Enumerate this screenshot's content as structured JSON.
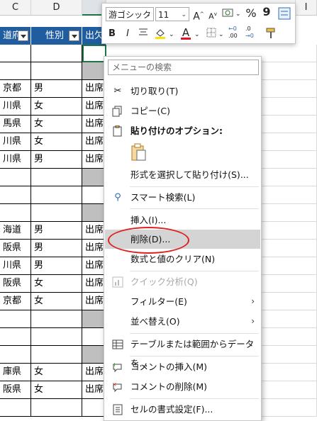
{
  "columns": {
    "c": "C",
    "d": "D",
    "i": "I"
  },
  "table_header": {
    "pref": "道府",
    "gender": "性別",
    "attend": "出欠"
  },
  "rows": [
    {
      "pref": "",
      "gender": "",
      "attend": "",
      "gray": false
    },
    {
      "pref": "",
      "gender": "",
      "attend": "",
      "gray": true
    },
    {
      "pref": "京都",
      "gender": "男",
      "attend": "出席",
      "gray": false
    },
    {
      "pref": "川県",
      "gender": "女",
      "attend": "出席",
      "gray": false
    },
    {
      "pref": "馬県",
      "gender": "女",
      "attend": "出席",
      "gray": false
    },
    {
      "pref": "川県",
      "gender": "女",
      "attend": "出席",
      "gray": false
    },
    {
      "pref": "川県",
      "gender": "男",
      "attend": "出席",
      "gray": false
    },
    {
      "pref": "",
      "gender": "",
      "attend": "",
      "gray": true
    },
    {
      "pref": "",
      "gender": "",
      "attend": "",
      "gray": false
    },
    {
      "pref": "",
      "gender": "",
      "attend": "",
      "gray": true
    },
    {
      "pref": "海道",
      "gender": "男",
      "attend": "出席",
      "gray": false
    },
    {
      "pref": "阪県",
      "gender": "男",
      "attend": "出席",
      "gray": false
    },
    {
      "pref": "川県",
      "gender": "男",
      "attend": "出席",
      "gray": false
    },
    {
      "pref": "阪県",
      "gender": "女",
      "attend": "出席",
      "gray": false
    },
    {
      "pref": "京都",
      "gender": "女",
      "attend": "出席",
      "gray": false
    },
    {
      "pref": "",
      "gender": "",
      "attend": "",
      "gray": true
    },
    {
      "pref": "",
      "gender": "",
      "attend": "",
      "gray": false
    },
    {
      "pref": "",
      "gender": "",
      "attend": "",
      "gray": true
    },
    {
      "pref": "庫県",
      "gender": "女",
      "attend": "出席",
      "gray": false
    },
    {
      "pref": "阪県",
      "gender": "女",
      "attend": "出席",
      "gray": false
    },
    {
      "pref": "",
      "gender": "",
      "attend": "",
      "gray": false
    }
  ],
  "mini_toolbar": {
    "font_name": "游ゴシック",
    "font_size": "11",
    "grow_font": "A",
    "shrink_font": "A",
    "percent": "%",
    "comma": "9",
    "bold": "B",
    "italic": "I",
    "font_color_letter": "A",
    "dec_more": ".00",
    "dec_less": ".0",
    "highlight_color": "#f5e400",
    "font_color": "#e81123"
  },
  "menu": {
    "search_placeholder": "メニューの検索",
    "cut": "切り取り(T)",
    "copy": "コピー(C)",
    "paste_options": "貼り付けのオプション:",
    "paste_special": "形式を選択して貼り付け(S)...",
    "smart_lookup": "スマート検索(L)",
    "insert": "挿入(I)...",
    "delete": "削除(D)...",
    "clear_contents": "数式と値のクリア(N)",
    "quick_analysis": "クイック分析(Q)",
    "filter": "フィルター(E)",
    "sort": "並べ替え(O)",
    "get_data": "テーブルまたは範囲からデータを...",
    "insert_comment": "コメントの挿入(M)",
    "delete_comment": "コメントの削除(M)",
    "format_cells": "セルの書式設定(F)...",
    "submenu_arrow": "›"
  },
  "highlight_color": "#e02020"
}
